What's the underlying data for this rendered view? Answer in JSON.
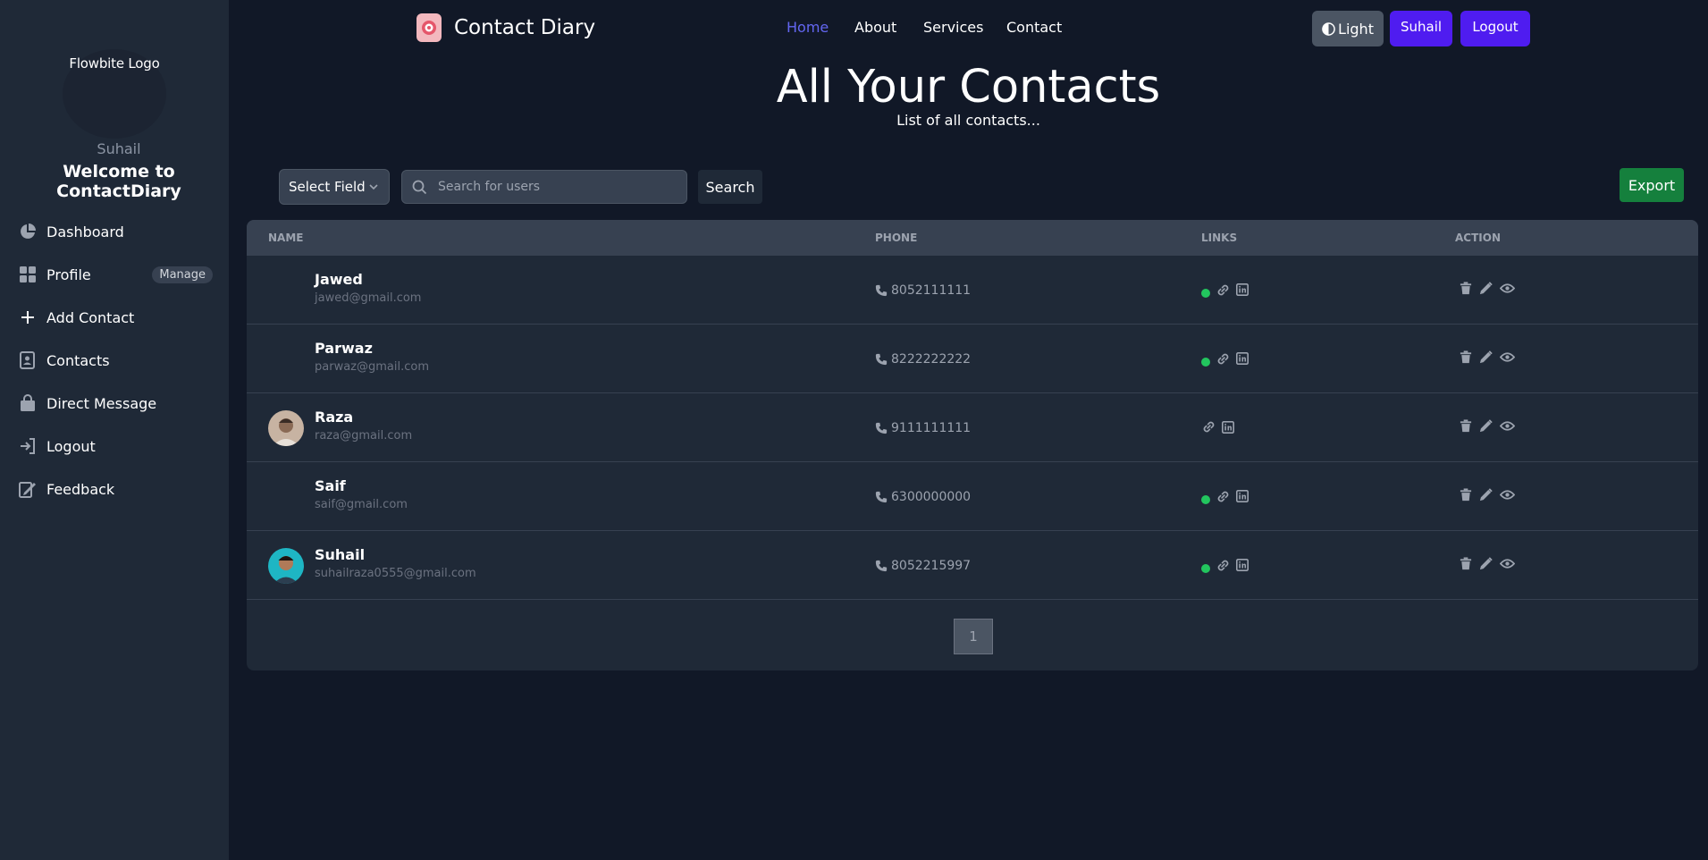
{
  "sidebar": {
    "logo_alt": "Flowbite Logo",
    "username": "Suhail",
    "welcome": "Welcome to ContactDiary",
    "items": [
      {
        "label": "Dashboard",
        "icon": "pie-chart-icon"
      },
      {
        "label": "Profile",
        "icon": "grid-icon",
        "badge": "Manage"
      },
      {
        "label": "Add Contact",
        "icon": "plus-icon"
      },
      {
        "label": "Contacts",
        "icon": "address-book-icon"
      },
      {
        "label": "Direct Message",
        "icon": "shopping-bag-icon"
      },
      {
        "label": "Logout",
        "icon": "sign-in-icon"
      },
      {
        "label": "Feedback",
        "icon": "edit-document-icon"
      }
    ]
  },
  "header": {
    "brand": "Contact Diary",
    "nav": [
      {
        "label": "Home",
        "active": true
      },
      {
        "label": "About",
        "active": false
      },
      {
        "label": "Services",
        "active": false
      },
      {
        "label": "Contact",
        "active": false
      }
    ],
    "theme_toggle": "Light",
    "user_button": "Suhail",
    "logout_button": "Logout"
  },
  "page": {
    "title": "All Your Contacts",
    "subtitle": "List of all contacts..."
  },
  "controls": {
    "select_field": "Select Field",
    "search_placeholder": "Search for users",
    "search_button": "Search",
    "export_button": "Export"
  },
  "table": {
    "headers": {
      "name": "NAME",
      "phone": "PHONE",
      "links": "LINKS",
      "action": "ACTION"
    },
    "rows": [
      {
        "name": "Jawed",
        "email": "jawed@gmail.com",
        "phone": "8052111111",
        "favorite": true,
        "avatar": "none"
      },
      {
        "name": "Parwaz",
        "email": "parwaz@gmail.com",
        "phone": "8222222222",
        "favorite": true,
        "avatar": "none"
      },
      {
        "name": "Raza",
        "email": "raza@gmail.com",
        "phone": "9111111111",
        "favorite": false,
        "avatar": "photo"
      },
      {
        "name": "Saif",
        "email": "saif@gmail.com",
        "phone": "6300000000",
        "favorite": true,
        "avatar": "none"
      },
      {
        "name": "Suhail",
        "email": "suhailraza0555@gmail.com",
        "phone": "8052215997",
        "favorite": true,
        "avatar": "photo"
      }
    ]
  },
  "pagination": {
    "current_page": "1"
  },
  "colors": {
    "background": "#111827",
    "sidebar": "#1f2937",
    "accent": "#4f1cf0",
    "active_link": "#6366f1",
    "export": "#15803d",
    "online_dot": "#22c55e"
  }
}
